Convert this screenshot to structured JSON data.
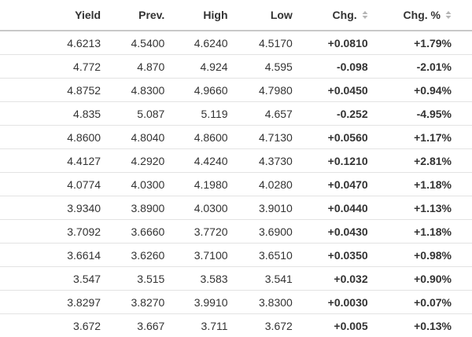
{
  "table": {
    "headers": {
      "yield": "Yield",
      "prev": "Prev.",
      "high": "High",
      "low": "Low",
      "chg": "Chg.",
      "chg_pct": "Chg. %"
    },
    "rows": [
      {
        "yield": "4.6213",
        "prev": "4.5400",
        "high": "4.6240",
        "low": "4.5170",
        "chg": "+0.0810",
        "chg_pct": "+1.79%"
      },
      {
        "yield": "4.772",
        "prev": "4.870",
        "high": "4.924",
        "low": "4.595",
        "chg": "-0.098",
        "chg_pct": "-2.01%"
      },
      {
        "yield": "4.8752",
        "prev": "4.8300",
        "high": "4.9660",
        "low": "4.7980",
        "chg": "+0.0450",
        "chg_pct": "+0.94%"
      },
      {
        "yield": "4.835",
        "prev": "5.087",
        "high": "5.119",
        "low": "4.657",
        "chg": "-0.252",
        "chg_pct": "-4.95%"
      },
      {
        "yield": "4.8600",
        "prev": "4.8040",
        "high": "4.8600",
        "low": "4.7130",
        "chg": "+0.0560",
        "chg_pct": "+1.17%"
      },
      {
        "yield": "4.4127",
        "prev": "4.2920",
        "high": "4.4240",
        "low": "4.3730",
        "chg": "+0.1210",
        "chg_pct": "+2.81%"
      },
      {
        "yield": "4.0774",
        "prev": "4.0300",
        "high": "4.1980",
        "low": "4.0280",
        "chg": "+0.0470",
        "chg_pct": "+1.18%"
      },
      {
        "yield": "3.9340",
        "prev": "3.8900",
        "high": "4.0300",
        "low": "3.9010",
        "chg": "+0.0440",
        "chg_pct": "+1.13%"
      },
      {
        "yield": "3.7092",
        "prev": "3.6660",
        "high": "3.7720",
        "low": "3.6900",
        "chg": "+0.0430",
        "chg_pct": "+1.18%"
      },
      {
        "yield": "3.6614",
        "prev": "3.6260",
        "high": "3.7100",
        "low": "3.6510",
        "chg": "+0.0350",
        "chg_pct": "+0.98%"
      },
      {
        "yield": "3.547",
        "prev": "3.515",
        "high": "3.583",
        "low": "3.541",
        "chg": "+0.032",
        "chg_pct": "+0.90%"
      },
      {
        "yield": "3.8297",
        "prev": "3.8270",
        "high": "3.9910",
        "low": "3.8300",
        "chg": "+0.0030",
        "chg_pct": "+0.07%"
      },
      {
        "yield": "3.672",
        "prev": "3.667",
        "high": "3.711",
        "low": "3.672",
        "chg": "+0.005",
        "chg_pct": "+0.13%"
      }
    ]
  },
  "icons": {
    "sort": "sort-icon"
  },
  "colors": {
    "positive": "#2e9d1b",
    "negative": "#d0021b"
  }
}
